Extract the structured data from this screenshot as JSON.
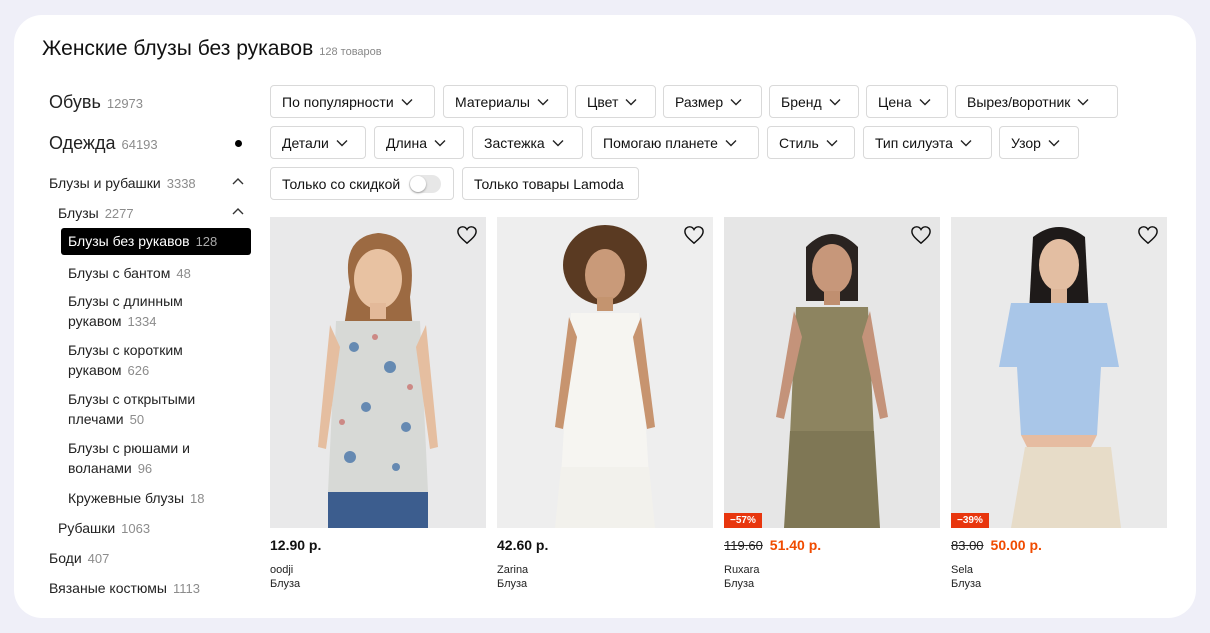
{
  "page": {
    "title": "Женские блузы без рукавов",
    "count": "128 товаров"
  },
  "sidebar": {
    "shoes": {
      "label": "Обувь",
      "count": "12973"
    },
    "clothes": {
      "label": "Одежда",
      "count": "64193"
    },
    "blouses_shirts": {
      "label": "Блузы и рубашки",
      "count": "3338"
    },
    "blouses": {
      "label": "Блузы",
      "count": "2277"
    },
    "sleeveless": {
      "label": "Блузы без рукавов",
      "count": "128"
    },
    "bow": {
      "label": "Блузы с бантом",
      "count": "48"
    },
    "long_sleeve": {
      "label": "Блузы с длинным рукавом",
      "count": "1334"
    },
    "short_sleeve": {
      "label": "Блузы с коротким рукавом",
      "count": "626"
    },
    "open_shoulders": {
      "label": "Блузы с открытыми плечами",
      "count": "50"
    },
    "ruffles": {
      "label": "Блузы с рюшами и воланами",
      "count": "96"
    },
    "lace": {
      "label": "Кружевные блузы",
      "count": "18"
    },
    "shirts": {
      "label": "Рубашки",
      "count": "1063"
    },
    "bodysuits": {
      "label": "Боди",
      "count": "407"
    },
    "knit_suits": {
      "label": "Вязаные костюмы",
      "count": "1113"
    }
  },
  "filters": [
    "По популярности",
    "Материалы",
    "Цвет",
    "Размер",
    "Бренд",
    "Цена",
    "Вырез/воротник",
    "Детали",
    "Длина",
    "Застежка",
    "Помогаю планете",
    "Стиль",
    "Тип силуэта",
    "Узор"
  ],
  "toggles": {
    "discount_only": "Только со скидкой",
    "lamoda_only": "Только товары Lamoda"
  },
  "products": [
    {
      "price": "12.90 р.",
      "old_price": "",
      "discount": "",
      "brand": "oodji",
      "type": "Блуза",
      "bg": "#e9e9ea"
    },
    {
      "price": "42.60 р.",
      "old_price": "",
      "discount": "",
      "brand": "Zarina",
      "type": "Блуза",
      "bg": "#eeeeee"
    },
    {
      "price": "51.40 р.",
      "old_price": "119.60",
      "discount": "−57%",
      "brand": "Ruxara",
      "type": "Блуза",
      "bg": "#e6e6e6"
    },
    {
      "price": "50.00 р.",
      "old_price": "83.00",
      "discount": "−39%",
      "brand": "Sela",
      "type": "Блуза",
      "bg": "#eaeaea"
    }
  ],
  "colors": {
    "accent_sale": "#f04b00",
    "badge": "#e8360e",
    "active_bg": "#000000"
  }
}
